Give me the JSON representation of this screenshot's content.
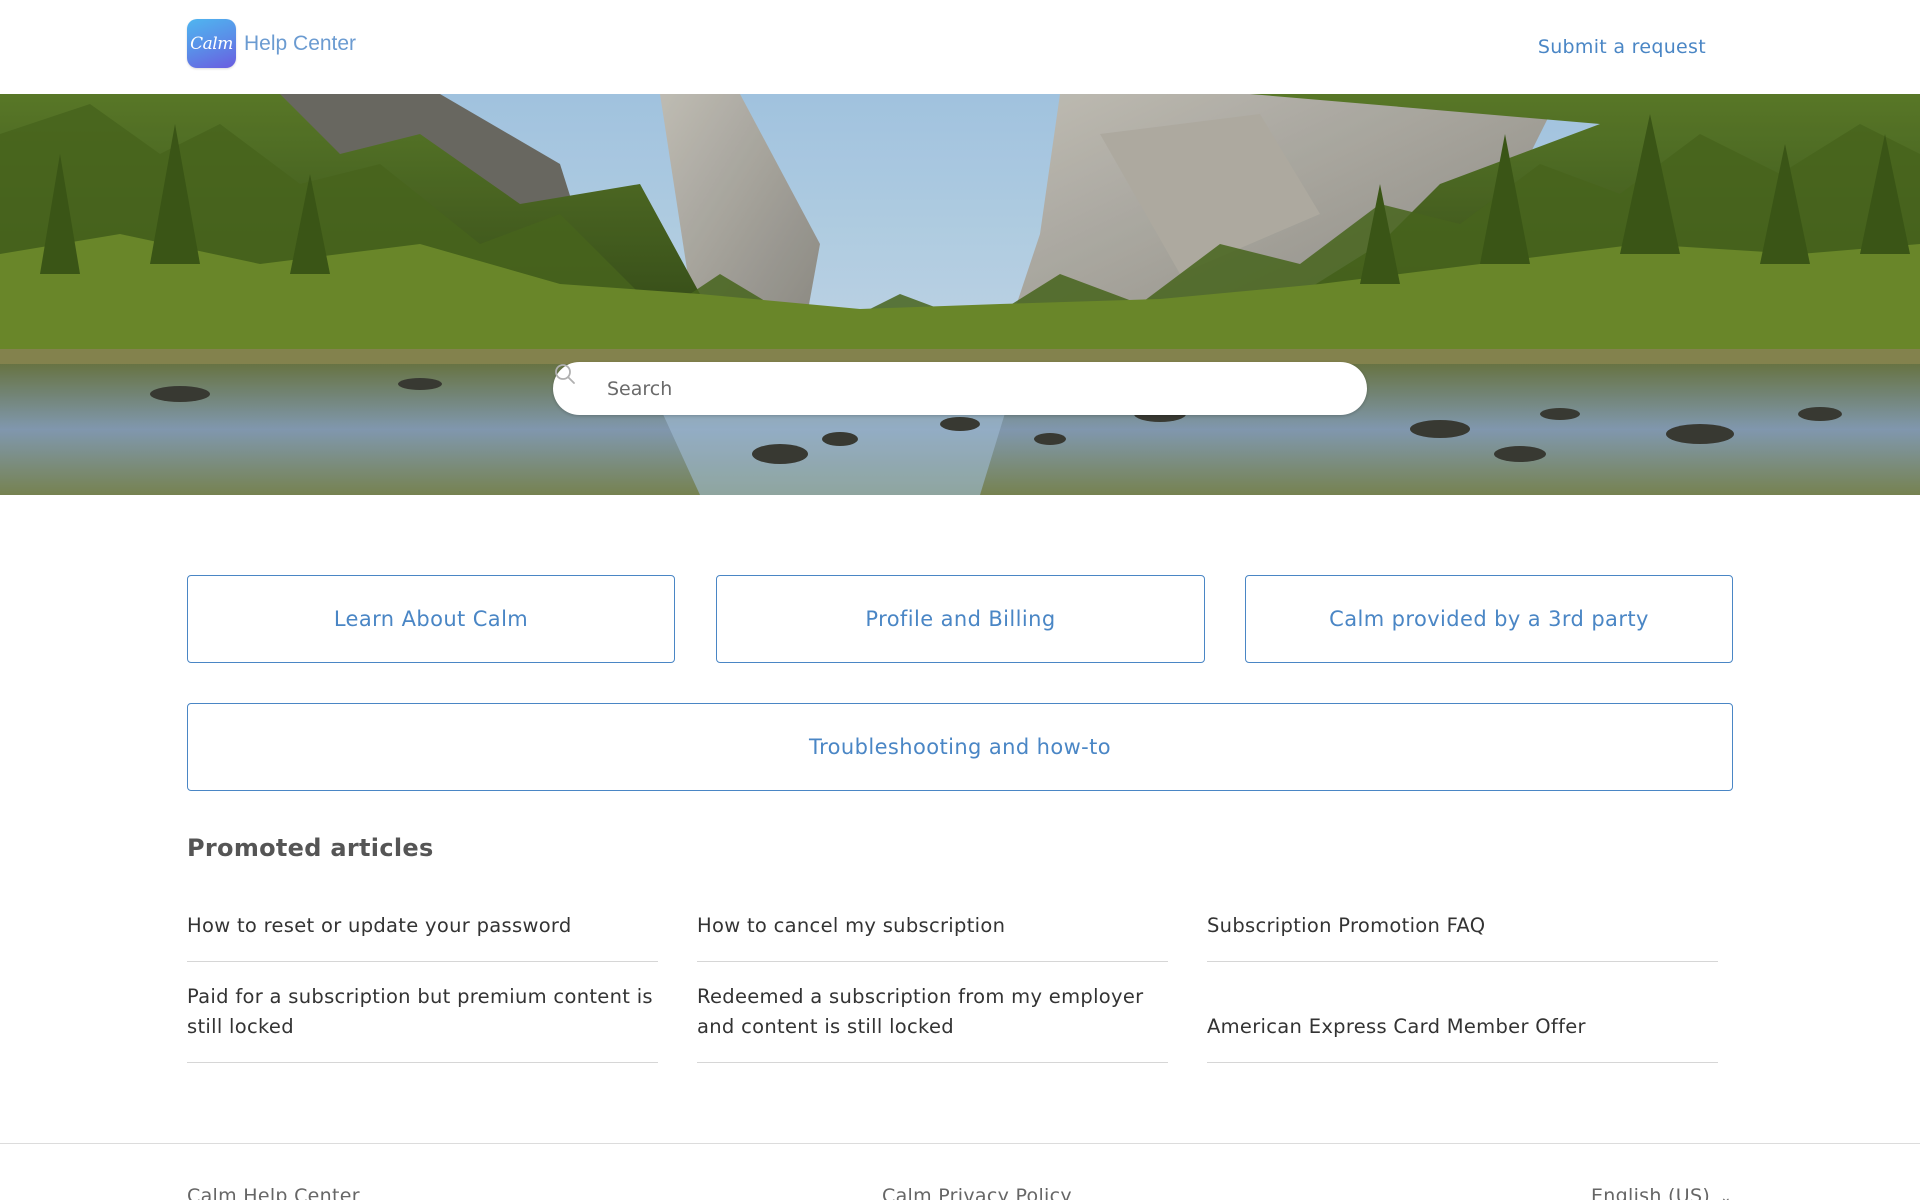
{
  "header": {
    "logo_badge_text": "Calm",
    "logo_text": "Help Center",
    "submit_label": "Submit a request"
  },
  "search": {
    "placeholder": "Search"
  },
  "categories": [
    {
      "label": "Learn About Calm"
    },
    {
      "label": "Profile and Billing"
    },
    {
      "label": "Calm provided by a 3rd party"
    },
    {
      "label": "Troubleshooting and how-to"
    }
  ],
  "promoted": {
    "title": "Promoted articles",
    "articles": [
      {
        "title": "How to reset or update your password"
      },
      {
        "title": "How to cancel my subscription"
      },
      {
        "title": "Subscription Promotion FAQ"
      },
      {
        "title": "Paid for a subscription but premium content is still locked"
      },
      {
        "title": "Redeemed a subscription from my employer and content is still locked"
      },
      {
        "title": "American Express Card Member Offer"
      }
    ]
  },
  "footer": {
    "left": "Calm Help Center",
    "center": "Calm Privacy Policy",
    "language": "English (US)"
  },
  "colors": {
    "accent": "#4a86c5",
    "text": "#333333",
    "divider": "#d6d6d6"
  }
}
